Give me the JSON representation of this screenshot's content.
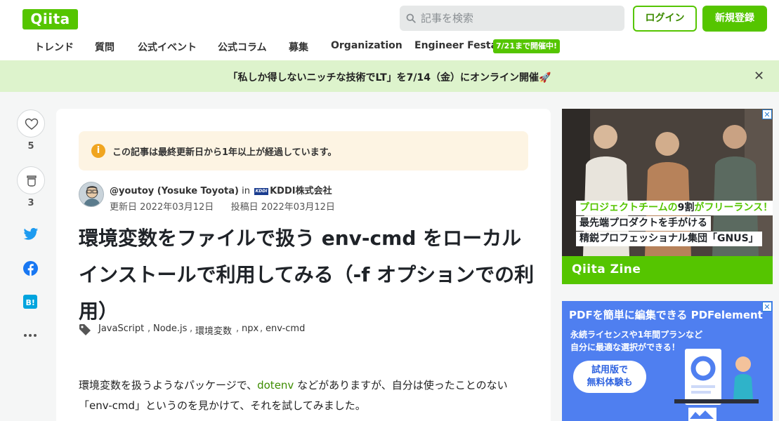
{
  "header": {
    "logo": "Qiita",
    "search_placeholder": "記事を検索",
    "login_label": "ログイン",
    "signup_label": "新規登録"
  },
  "nav": {
    "items": [
      "トレンド",
      "質問",
      "公式イベント",
      "公式コラム",
      "募集",
      "Organization",
      "Engineer Festa"
    ],
    "badge": "7/21まで開催中!"
  },
  "banner": {
    "text": "「私しか得しないニッチな技術でLT」を7/14（金）にオンライン開催🚀",
    "close": "✕"
  },
  "rail": {
    "likes": "5",
    "stocks": "3"
  },
  "article": {
    "notice": "この記事は最終更新日から1年以上が経過しています。",
    "author_handle": "@youtoy (Yosuke Toyota)",
    "in_label": "in",
    "org_logo": "KDDI",
    "org": "KDDI株式会社",
    "updated": "更新日 2022年03月12日",
    "posted": "投稿日 2022年03月12日",
    "title": "環境変数をファイルで扱う env-cmd をローカルインストールで利用してみる（-f オプションでの利用）",
    "tags": [
      "JavaScript",
      "Node.js",
      "環境変数",
      "npx",
      "env-cmd"
    ],
    "body_pre": "環境変数を扱うようなパッケージで、",
    "body_link": "dotenv",
    "body_post": " などがありますが、自分は使ったことのない「env-cmd」というのを見かけて、それを試してみました。"
  },
  "ads": {
    "zine": {
      "line1_a": "プロジェクトチームの",
      "line1_b": "9割",
      "line1_c": "がフリーランス！",
      "line2": "最先端プロダクトを手がける",
      "line3": "精鋭プロフェッショナル集団「GNUS」",
      "brand": "Qiita Zine"
    },
    "pdf": {
      "title": "PDFを簡単に編集できる PDFelement",
      "line1": "永続ライセンスや1年間プランなど",
      "line2": "自分に最適な選択ができる！",
      "button": "試用版で\n無料体験も"
    }
  },
  "colors": {
    "brand_green": "#55c500",
    "banner_bg": "#ddf3cc",
    "notice_bg": "#fdf4e3",
    "link": "#3d8c00"
  }
}
